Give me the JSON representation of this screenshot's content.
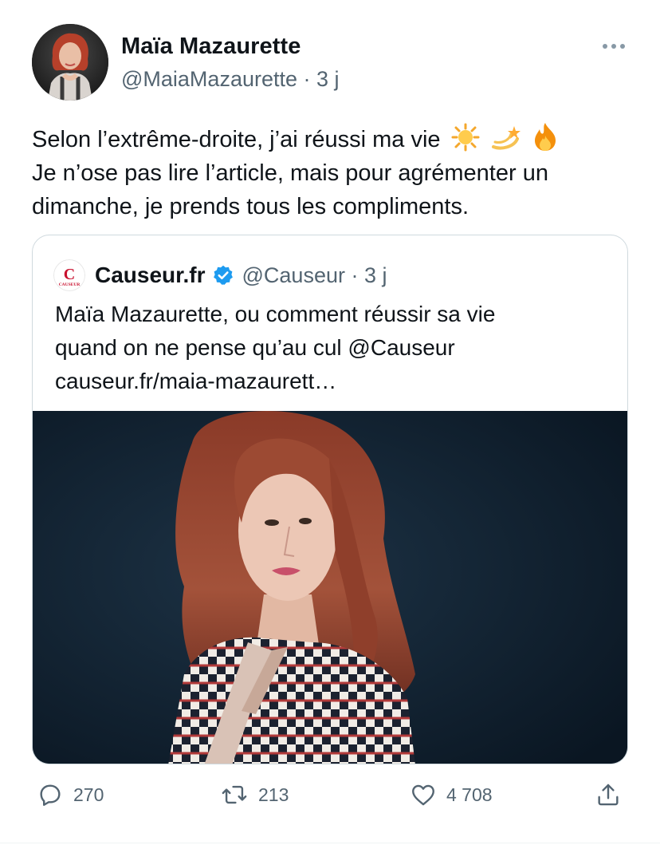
{
  "author": {
    "name": "Maïa Mazaurette",
    "handle": "@MaiaMazaurette",
    "separator": "·",
    "time": "3 j"
  },
  "tweet": {
    "lines": [
      "Selon l’extrême-droite, j’ai réussi ma vie",
      "Je n’ose pas lire l’article, mais pour agrémenter un",
      "dimanche, je prends tous les compliments."
    ],
    "emojis": [
      "sun-emoji",
      "dizzy-emoji",
      "fire-emoji"
    ]
  },
  "quote": {
    "logo_text": "C",
    "logo_subtext": "CAUSEUR",
    "name": "Causeur.fr",
    "verified": true,
    "handle": "@Causeur",
    "separator": "·",
    "time": "3 j",
    "lines": [
      "Maïa Mazaurette, ou comment réussir sa vie",
      "quand on ne pense qu’au cul @Causeur",
      "causeur.fr/maia-mazaurett…"
    ],
    "image": "portrait-photo"
  },
  "actions": {
    "reply": {
      "icon": "reply-icon",
      "count": "270"
    },
    "retweet": {
      "icon": "retweet-icon",
      "count": "213"
    },
    "like": {
      "icon": "heart-icon",
      "count": "4 708"
    },
    "share": {
      "icon": "share-icon"
    }
  },
  "colors": {
    "text": "#0f1419",
    "secondary": "#536471",
    "border": "#cfd9de",
    "verified": "#1d9bf0",
    "causeur_red": "#c8102e"
  }
}
